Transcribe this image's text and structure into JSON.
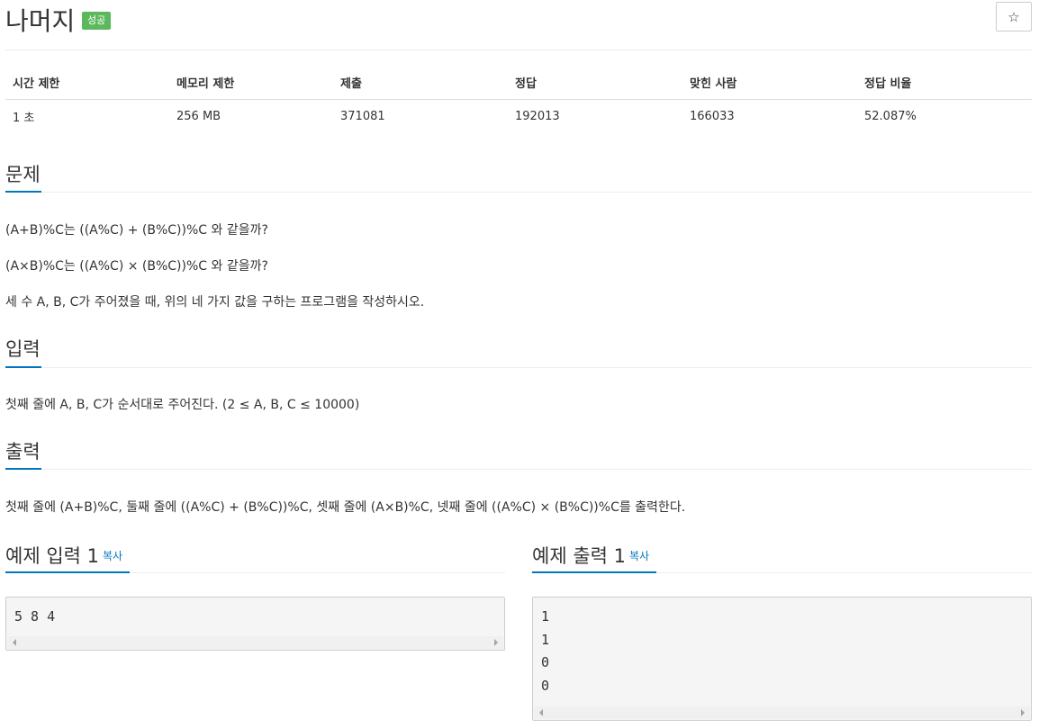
{
  "problem": {
    "title": "나머지",
    "status_badge": "성공",
    "star_icon": "☆"
  },
  "info_table": {
    "headers": [
      "시간 제한",
      "메모리 제한",
      "제출",
      "정답",
      "맞힌 사람",
      "정답 비율"
    ],
    "values": [
      "1 초",
      "256 MB",
      "371081",
      "192013",
      "166033",
      "52.087%"
    ]
  },
  "sections": {
    "problem": {
      "heading": "문제",
      "lines": [
        "(A+B)%C는 ((A%C) + (B%C))%C 와 같을까?",
        "(A×B)%C는 ((A%C) × (B%C))%C 와 같을까?",
        "세 수 A, B, C가 주어졌을 때, 위의 네 가지 값을 구하는 프로그램을 작성하시오."
      ]
    },
    "input": {
      "heading": "입력",
      "text": "첫째 줄에 A, B, C가 순서대로 주어진다. (2 ≤ A, B, C ≤ 10000)"
    },
    "output": {
      "heading": "출력",
      "text": "첫째 줄에 (A+B)%C, 둘째 줄에 ((A%C) + (B%C))%C, 셋째 줄에 (A×B)%C, 넷째 줄에 ((A%C) × (B%C))%C를 출력한다."
    }
  },
  "samples": {
    "input": {
      "heading": "예제 입력 1",
      "copy_label": "복사",
      "lines": [
        "5 8 4"
      ]
    },
    "output": {
      "heading": "예제 출력 1",
      "copy_label": "복사",
      "lines": [
        "1",
        "1",
        "0",
        "0"
      ]
    }
  },
  "colors": {
    "accent": "#0076c0",
    "success_badge": "#5cb85c",
    "pre_background": "#f5f5f5"
  }
}
